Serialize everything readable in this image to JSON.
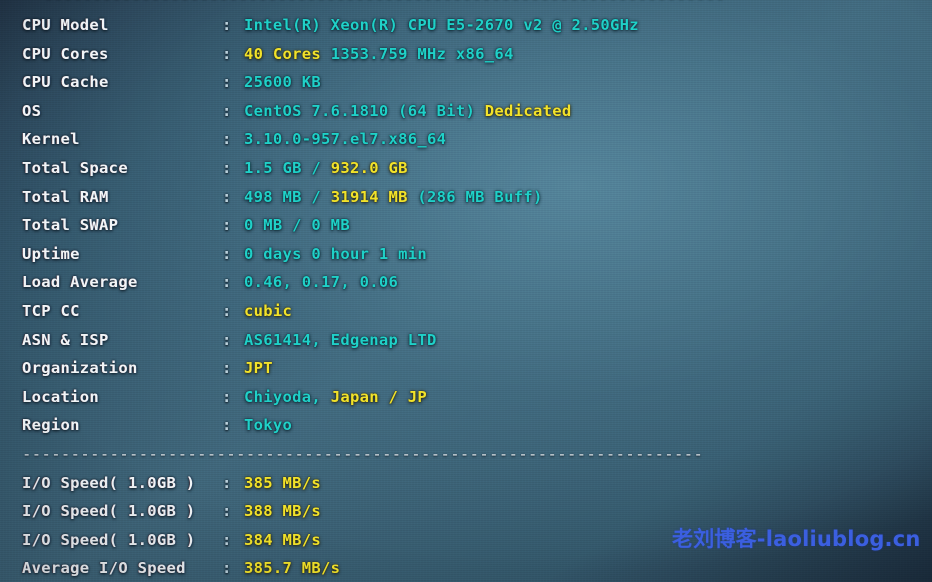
{
  "terminal": {
    "top_rule": "----------------------------------------------------------------------",
    "mid_rule": "----------------------------------------------------------------------",
    "colon": ":",
    "info_rows": [
      {
        "label": "CPU Model",
        "parts": [
          {
            "text": "Intel(R) Xeon(R) CPU E5-2670 v2 @ 2.50GHz",
            "color": "cyan"
          }
        ]
      },
      {
        "label": "CPU Cores",
        "parts": [
          {
            "text": "40 Cores",
            "color": "yellow"
          },
          {
            "text": " 1353.759 MHz x86_64",
            "color": "cyan"
          }
        ]
      },
      {
        "label": "CPU Cache",
        "parts": [
          {
            "text": "25600 KB",
            "color": "cyan"
          }
        ]
      },
      {
        "label": "OS",
        "parts": [
          {
            "text": "CentOS 7.6.1810 (64 Bit) ",
            "color": "cyan"
          },
          {
            "text": "Dedicated",
            "color": "yellow"
          }
        ]
      },
      {
        "label": "Kernel",
        "parts": [
          {
            "text": "3.10.0-957.el7.x86_64",
            "color": "cyan"
          }
        ]
      },
      {
        "label": "Total Space",
        "parts": [
          {
            "text": "1.5 GB / ",
            "color": "cyan"
          },
          {
            "text": "932.0 GB",
            "color": "yellow"
          }
        ]
      },
      {
        "label": "Total RAM",
        "parts": [
          {
            "text": "498 MB / ",
            "color": "cyan"
          },
          {
            "text": "31914 MB",
            "color": "yellow"
          },
          {
            "text": " (286 MB Buff)",
            "color": "cyan"
          }
        ]
      },
      {
        "label": "Total SWAP",
        "parts": [
          {
            "text": "0 MB / 0 MB",
            "color": "cyan"
          }
        ]
      },
      {
        "label": "Uptime",
        "parts": [
          {
            "text": "0 days 0 hour 1 min",
            "color": "cyan"
          }
        ]
      },
      {
        "label": "Load Average",
        "parts": [
          {
            "text": "0.46, 0.17, 0.06",
            "color": "cyan"
          }
        ]
      },
      {
        "label": "TCP CC",
        "parts": [
          {
            "text": "cubic",
            "color": "yellow"
          }
        ]
      },
      {
        "label": "ASN & ISP",
        "parts": [
          {
            "text": "AS61414, Edgenap LTD",
            "color": "cyan"
          }
        ]
      },
      {
        "label": "Organization",
        "parts": [
          {
            "text": "JPT",
            "color": "yellow"
          }
        ]
      },
      {
        "label": "Location",
        "parts": [
          {
            "text": "Chiyoda, ",
            "color": "cyan"
          },
          {
            "text": "Japan / JP",
            "color": "yellow"
          }
        ]
      },
      {
        "label": "Region",
        "parts": [
          {
            "text": "Tokyo",
            "color": "cyan"
          }
        ]
      }
    ],
    "io_rows": [
      {
        "label": "I/O Speed( 1.0GB )",
        "parts": [
          {
            "text": "385 MB/s",
            "color": "yellow"
          }
        ]
      },
      {
        "label": "I/O Speed( 1.0GB )",
        "parts": [
          {
            "text": "388 MB/s",
            "color": "yellow"
          }
        ]
      },
      {
        "label": "I/O Speed( 1.0GB )",
        "parts": [
          {
            "text": "384 MB/s",
            "color": "yellow"
          }
        ]
      },
      {
        "label": "Average I/O Speed",
        "parts": [
          {
            "text": "385.7 MB/s",
            "color": "yellow"
          }
        ]
      }
    ]
  },
  "watermark": {
    "text": "老刘博客-laoliublog.cn"
  },
  "colors": {
    "label": "#f2f5f7",
    "value_cyan": "#1fd1c8",
    "value_yellow": "#f2e32a",
    "watermark": "#3b5fe0",
    "background": "#3c6377"
  }
}
